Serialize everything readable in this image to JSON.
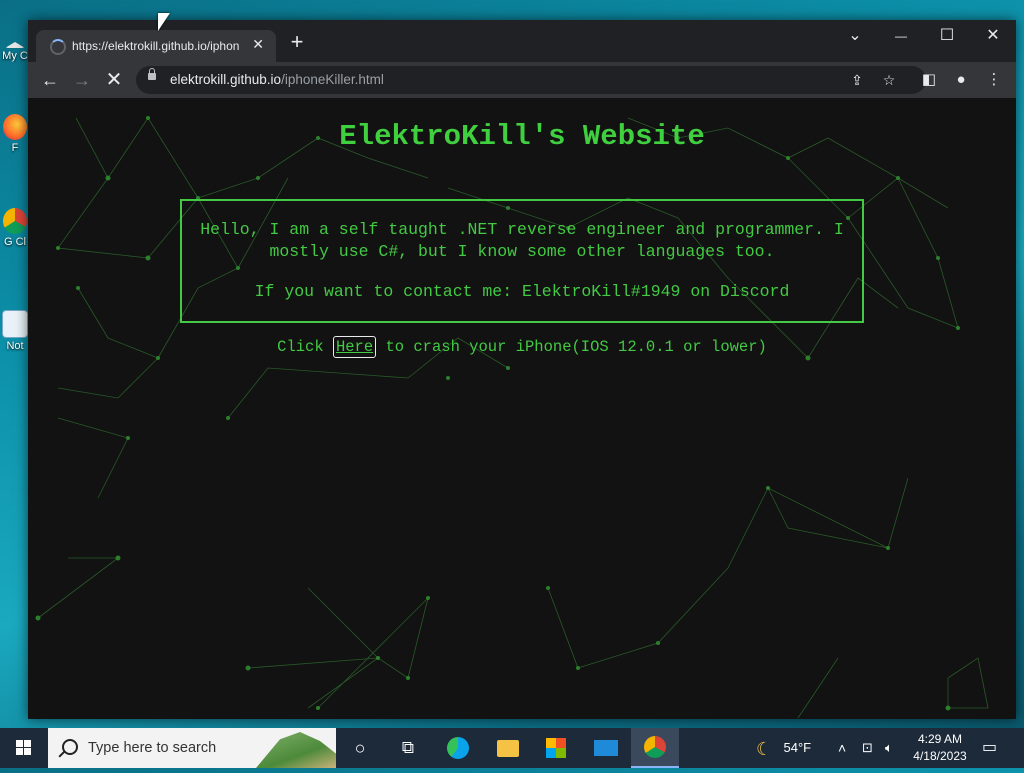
{
  "desktop": {
    "icons": [
      {
        "label": "My C",
        "icon": "this-pc-icon"
      },
      {
        "label": "F",
        "icon": "firefox-icon"
      },
      {
        "label": "G Cl",
        "icon": "chrome-icon"
      },
      {
        "label": "Not",
        "icon": "notepad-icon"
      }
    ]
  },
  "browser": {
    "tab": {
      "title": "https://elektrokill.github.io/iphon",
      "close": "✕"
    },
    "new_tab": "+",
    "window_controls": {
      "dropdown": "⌄",
      "minimize": "—",
      "maximize": "☐",
      "close": "✕"
    },
    "address": {
      "domain": "elektrokill.github.io",
      "path": "/iphoneKiller.html"
    }
  },
  "page": {
    "title": "ElektroKill's Website",
    "intro": "Hello, I am a self taught .NET reverse engineer and programmer. I mostly use C#, but I know some other languages too.",
    "contact": "If you want to contact me: ElektroKill#1949 on Discord",
    "crash_prefix": "Click ",
    "crash_link": "Here",
    "crash_suffix": " to crash your iPhone(IOS 12.0.1 or lower)",
    "accent_color": "#43c943"
  },
  "taskbar": {
    "search_placeholder": "Type here to search",
    "weather": "54°F",
    "time": "4:29 AM",
    "date": "4/18/2023"
  }
}
